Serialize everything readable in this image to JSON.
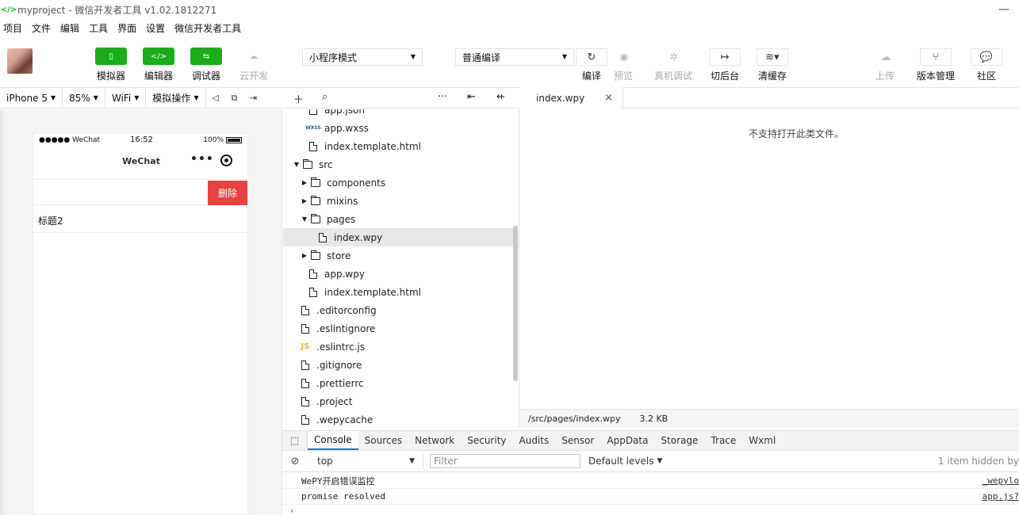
{
  "window": {
    "title": "myproject - 微信开发者工具 v1.02.1812271",
    "minimize": "—"
  },
  "menu": [
    "项目",
    "文件",
    "编辑",
    "工具",
    "界面",
    "设置",
    "微信开发者工具"
  ],
  "toolbar": {
    "simulator": "模拟器",
    "editor": "编辑器",
    "debugger": "调试器",
    "cloud": "云开发",
    "mode": "小程序模式",
    "compile_mode": "普通编译",
    "compile": "编译",
    "preview": "预览",
    "remote_debug": "真机调试",
    "background": "切后台",
    "clear_cache": "清缓存",
    "upload": "上传",
    "version": "版本管理",
    "community": "社区"
  },
  "devicebar": {
    "device": "iPhone 5",
    "zoom": "85%",
    "network": "WiFi",
    "operation": "模拟操作"
  },
  "phone": {
    "signal": "●●●●● WeChat",
    "time": "16:52",
    "battery": "100%",
    "nav_title": "WeChat",
    "delete_label": "删除",
    "item2": "标题2"
  },
  "tree": {
    "rows": [
      {
        "label": "app.json",
        "depth": 2,
        "kind": "file"
      },
      {
        "label": "app.wxss",
        "depth": 2,
        "kind": "wxss"
      },
      {
        "label": "index.template.html",
        "depth": 2,
        "kind": "file"
      },
      {
        "label": "src",
        "depth": 1,
        "kind": "folder-open"
      },
      {
        "label": "components",
        "depth": 2,
        "kind": "folder"
      },
      {
        "label": "mixins",
        "depth": 2,
        "kind": "folder"
      },
      {
        "label": "pages",
        "depth": 2,
        "kind": "folder-open"
      },
      {
        "label": "index.wpy",
        "depth": 3,
        "kind": "file",
        "selected": true
      },
      {
        "label": "store",
        "depth": 2,
        "kind": "folder"
      },
      {
        "label": "app.wpy",
        "depth": 2,
        "kind": "file"
      },
      {
        "label": "index.template.html",
        "depth": 2,
        "kind": "file"
      },
      {
        "label": ".editorconfig",
        "depth": 1,
        "kind": "file"
      },
      {
        "label": ".eslintignore",
        "depth": 1,
        "kind": "file"
      },
      {
        "label": ".eslintrc.js",
        "depth": 1,
        "kind": "js"
      },
      {
        "label": ".gitignore",
        "depth": 1,
        "kind": "file"
      },
      {
        "label": ".prettierrc",
        "depth": 1,
        "kind": "file"
      },
      {
        "label": ".project",
        "depth": 1,
        "kind": "file"
      },
      {
        "label": ".wepycache",
        "depth": 1,
        "kind": "file"
      }
    ]
  },
  "editor": {
    "tab": "index.wpy",
    "message": "不支持打开此类文件。",
    "status_path": "/src/pages/index.wpy",
    "status_size": "3.2 KB"
  },
  "devtools": {
    "tabs": [
      "Console",
      "Sources",
      "Network",
      "Security",
      "Audits",
      "Sensor",
      "AppData",
      "Storage",
      "Trace",
      "Wxml"
    ],
    "active_tab": "Console",
    "context": "top",
    "filter_placeholder": "Filter",
    "levels": "Default levels",
    "hidden": "1 item hidden by",
    "logs": [
      {
        "text": "WePY开启错误监控",
        "source": "_wepylo"
      },
      {
        "text": "promise resolved",
        "source": "app.js?"
      }
    ],
    "prompt": "›"
  },
  "colors": {
    "accent_green": "#1aad19",
    "delete_red": "#e64340",
    "active_tab_blue": "#1a73e8"
  }
}
